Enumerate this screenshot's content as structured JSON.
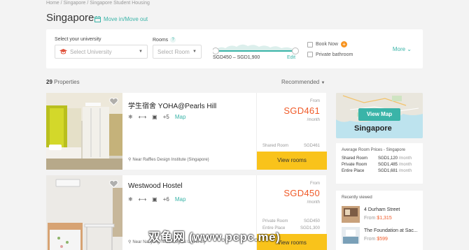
{
  "breadcrumb": "Home / Singapore / Singapore Student Housing",
  "page_title": "Singapore",
  "move_link": "Move in/Move out",
  "filters": {
    "university_label": "Select your university",
    "university_placeholder": "Select University",
    "rooms_label": "Rooms",
    "rooms_help": "?",
    "rooms_placeholder": "Select Room",
    "price_range": "SGD450 – SGD1,900",
    "edit": "Edit",
    "book_now": "Book Now",
    "private_bathroom": "Private bathroom",
    "more": "More"
  },
  "results": {
    "count": "29",
    "count_label": "Properties",
    "sort": "Recommended"
  },
  "properties": [
    {
      "name": "学生宿舍 YOHA@Pearls Hill",
      "extra": "+5",
      "map": "Map",
      "location": "Near Raffles Design Institute (Singapore)",
      "from": "From",
      "price": "SGD461",
      "per": "/month",
      "rows": [
        {
          "label": "Shared Room",
          "value": "SGD461"
        }
      ],
      "button": "View rooms"
    },
    {
      "name": "Westwood Hostel",
      "extra": "+6",
      "map": "Map",
      "location": "Near Nanyang Technological University",
      "from": "From",
      "price": "SGD450",
      "per": "/month",
      "rows": [
        {
          "label": "Private Room",
          "value": "SGD450"
        },
        {
          "label": "Entire Place",
          "value": "SGD1,300"
        }
      ],
      "button": "View rooms"
    }
  ],
  "map_card": {
    "button": "View Map",
    "label": "Singapore"
  },
  "avg_prices": {
    "title": "Average Room Prices - Singapore",
    "rows": [
      {
        "label": "Shared Room",
        "value": "SGD1,120",
        "unit": "/month"
      },
      {
        "label": "Private Room",
        "value": "SGD1,485",
        "unit": "/month"
      },
      {
        "label": "Entire Place",
        "value": "SGD1,681",
        "unit": "/month"
      }
    ]
  },
  "recently_viewed": {
    "title": "Recently viewed",
    "items": [
      {
        "name": "4 Durham Street",
        "from": "From",
        "price": "$1,315"
      },
      {
        "name": "The Foundation at Sac...",
        "from": "From",
        "price": "$599"
      }
    ]
  },
  "watermark": "双龟网 (www.pcpc.me)",
  "colors": {
    "accent": "#3ab4a8",
    "price": "#f05a28",
    "cta": "#f9c31b"
  }
}
